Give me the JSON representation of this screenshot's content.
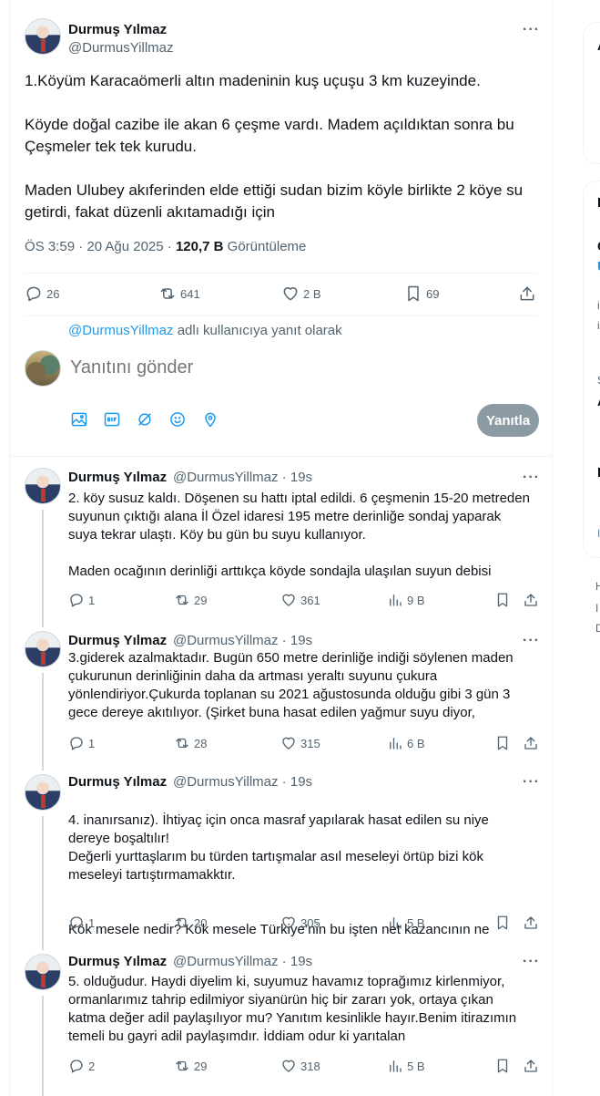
{
  "main_tweet": {
    "author_name": "Durmuş Yılmaz",
    "author_handle": "@DurmusYillmaz",
    "paragraphs": [
      "1.Köyüm Karacaömerli altın madeninin kuş uçuşu 3 km kuzeyinde.",
      "Köyde doğal cazibe ile akan 6 çeşme vardı. Madem açıldıktan sonra bu Çeşmeler tek tek kurudu.",
      "Maden Ulubey  akıferinden elde ettiği  sudan bizim köyle birlikte  2 köye su getirdi, fakat düzenli akıtamadığı için"
    ],
    "timestamp": "ÖS 3:59 · 20 Ağu 2025 · ",
    "views_count": "120,7 B",
    "views_label": " Görüntüleme",
    "replies": "26",
    "retweets": "641",
    "likes": "2 B",
    "bookmarks": "69"
  },
  "composer": {
    "reply_to_handle": "@DurmusYillmaz",
    "reply_to_suffix": " adlı kullanıcıya yanıt olarak",
    "placeholder": "Yanıtını gönder",
    "reply_button": "Yanıtla"
  },
  "replies": [
    {
      "author_name": "Durmuş Yılmaz",
      "handle_time": "@DurmusYillmaz · 19s",
      "paragraphs": [
        "2. köy susuz kaldı. Döşenen su hattı iptal edildi. 6 çeşmenin 15-20 metreden suyunun çıktığı alana İl Özel idaresi  195 metre derinliğe sondaj yaparak suya tekrar ulaştı. Köy bu gün bu suyu kullanıyor.",
        "Maden ocağının derinliği arttıkça köyde sondajla ulaşılan suyun debisi"
      ],
      "replies": "1",
      "retweets": "29",
      "likes": "361",
      "views": "9 B"
    },
    {
      "author_name": "Durmuş Yılmaz",
      "handle_time": "@DurmusYillmaz · 19s",
      "paragraphs": [
        "3.giderek azalmaktadır. Bugün 650 metre derinliğe indiği söylenen maden çukurunun  derinliğinin daha da artması yeraltı suyunu çukura yönlendiriyor.Çukurda toplanan su 2021 ağustosunda olduğu gibi 3 gün 3 gece dereye akıtılıyor. (Şirket buna hasat edilen yağmur suyu diyor,"
      ],
      "replies": "1",
      "retweets": "28",
      "likes": "315",
      "views": "6 B"
    },
    {
      "author_name": "Durmuş Yılmaz",
      "handle_time": "@DurmusYillmaz · 19s",
      "paragraphs": [
        "4. inanırsanız). İhtiyaç için onca masraf yapılarak hasat edilen su  niye dereye boşaltılır!\nDeğerli yurttaşlarım  bu türden tartışmalar asıl meseleyi örtüp bizi kök meseleyi tartıştırmamakktır.",
        "Kök mesele nedir? Kök mesele Türkiye’nin bu işten net kazancının ne"
      ],
      "replies": "1",
      "retweets": "20",
      "likes": "305",
      "views": "5 B"
    },
    {
      "author_name": "Durmuş Yılmaz",
      "handle_time": "@DurmusYillmaz · 19s",
      "paragraphs": [
        "5. olduğudur. Haydi diyelim ki, suyumuz havamız toprağımız kirlenmiyor, ormanlarımız tahrip edilmiyor siyanürün hiç bir zararı yok, ortaya çıkan katma değer adil paylaşılıyor mu? Yanıtım kesinlikle hayır.Benim itirazımın temeli bu gayri adil paylaşımdır. İddiam odur ki yarıtalan"
      ],
      "replies": "2",
      "retweets": "29",
      "likes": "318",
      "views": "5 B"
    }
  ],
  "right_column": {
    "chars": [
      "A",
      "I",
      "C",
      "U",
      "i",
      "i",
      "S",
      "A",
      "I",
      "I",
      "H",
      "I",
      "D"
    ]
  },
  "colors": {
    "accent": "#1d9bf0",
    "muted": "#536471",
    "text": "#0f1419",
    "border": "#eff3f4",
    "disabled_button": "#8c9aa3"
  }
}
